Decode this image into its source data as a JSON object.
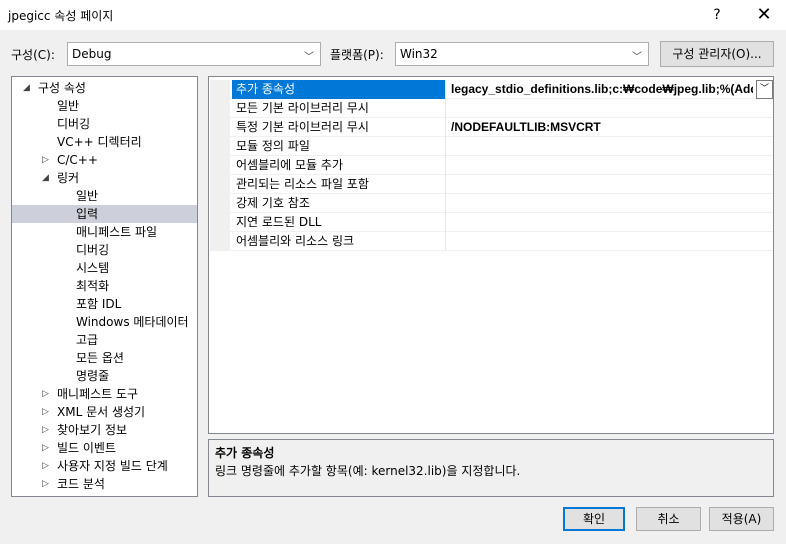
{
  "window": {
    "title": "jpegicc 속성 페이지",
    "help": "?",
    "close": "✕"
  },
  "config": {
    "config_label": "구성(C):",
    "config_value": "Debug",
    "platform_label": "플랫폼(P):",
    "platform_value": "Win32",
    "manager_button": "구성 관리자(O)..."
  },
  "tree": {
    "items": [
      {
        "label": "구성 속성",
        "expander": "◢"
      },
      {
        "label": "일반"
      },
      {
        "label": "디버깅"
      },
      {
        "label": "VC++ 디렉터리"
      },
      {
        "label": "C/C++",
        "expander": "▷"
      },
      {
        "label": "링커",
        "expander": "◢"
      },
      {
        "label": "일반"
      },
      {
        "label": "입력"
      },
      {
        "label": "매니페스트 파일"
      },
      {
        "label": "디버깅"
      },
      {
        "label": "시스템"
      },
      {
        "label": "최적화"
      },
      {
        "label": "포함 IDL"
      },
      {
        "label": "Windows 메타데이터"
      },
      {
        "label": "고급"
      },
      {
        "label": "모든 옵션"
      },
      {
        "label": "명령줄"
      },
      {
        "label": "매니페스트 도구",
        "expander": "▷"
      },
      {
        "label": "XML 문서 생성기",
        "expander": "▷"
      },
      {
        "label": "찾아보기 정보",
        "expander": "▷"
      },
      {
        "label": "빌드 이벤트",
        "expander": "▷"
      },
      {
        "label": "사용자 지정 빌드 단계",
        "expander": "▷"
      },
      {
        "label": "코드 분석",
        "expander": "▷"
      }
    ]
  },
  "grid": {
    "rows": [
      {
        "name": "추가 종속성",
        "value": "legacy_stdio_definitions.lib;c:₩code₩jpeg.lib;%(AdditionalDependencies)"
      },
      {
        "name": "모든 기본 라이브러리 무시",
        "value": ""
      },
      {
        "name": "특정 기본 라이브러리 무시",
        "value": "/NODEFAULTLIB:MSVCRT"
      },
      {
        "name": "모듈 정의 파일",
        "value": ""
      },
      {
        "name": "어셈블리에 모듈 추가",
        "value": ""
      },
      {
        "name": "관리되는 리소스 파일 포함",
        "value": ""
      },
      {
        "name": "강제 기호 참조",
        "value": ""
      },
      {
        "name": "지연 로드된 DLL",
        "value": ""
      },
      {
        "name": "어셈블리와 리소스 링크",
        "value": ""
      }
    ],
    "dropdown_icon": "chevron-down-icon"
  },
  "description": {
    "title": "추가 종속성",
    "text": "링크 명령줄에 추가할 항목(예: kernel32.lib)을 지정합니다."
  },
  "buttons": {
    "ok": "확인",
    "cancel": "취소",
    "apply": "적용(A)"
  }
}
